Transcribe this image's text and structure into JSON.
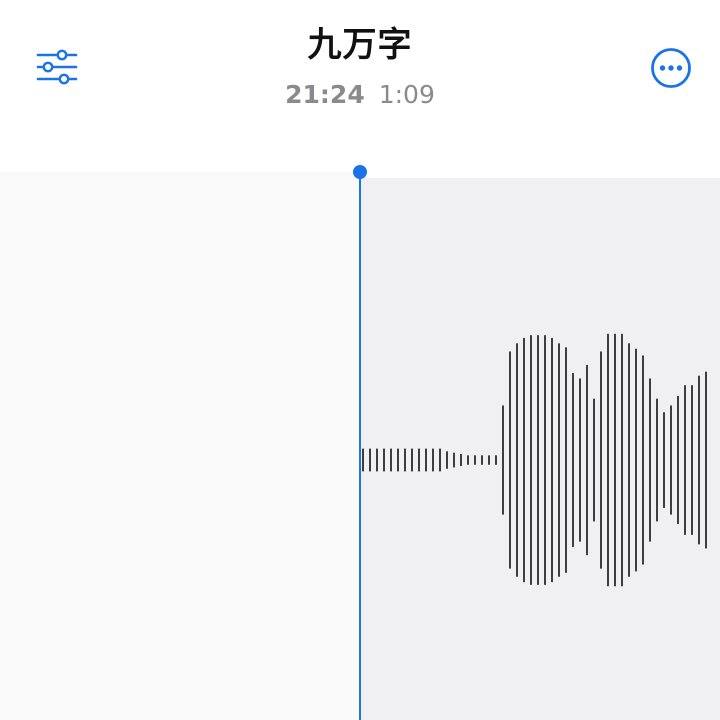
{
  "recording": {
    "title": "九万字",
    "time": "21:24",
    "duration": "1:09"
  },
  "toolbar": {
    "settings_icon": "sliders-icon",
    "more_icon": "ellipsis-circle-icon"
  },
  "colors": {
    "accent": "#1a73e8",
    "title_text": "#111111",
    "secondary_text": "#8a8a8e",
    "waveform": "#111111",
    "played_bg": "#fafafb",
    "pending_bg": "#f0f0f2"
  },
  "waveform": {
    "amplitudes": [
      0.08,
      0.08,
      0.08,
      0.08,
      0.08,
      0.08,
      0.08,
      0.08,
      0.08,
      0.08,
      0.08,
      0.08,
      0.06,
      0.05,
      0.04,
      0.03,
      0.03,
      0.03,
      0.03,
      0.03,
      0.4,
      0.8,
      0.86,
      0.9,
      0.92,
      0.92,
      0.92,
      0.9,
      0.86,
      0.83,
      0.64,
      0.6,
      0.7,
      0.45,
      0.8,
      0.93,
      0.93,
      0.93,
      0.86,
      0.82,
      0.77,
      0.6,
      0.45,
      0.35,
      0.4,
      0.47,
      0.55,
      0.55,
      0.62,
      0.65
    ]
  }
}
